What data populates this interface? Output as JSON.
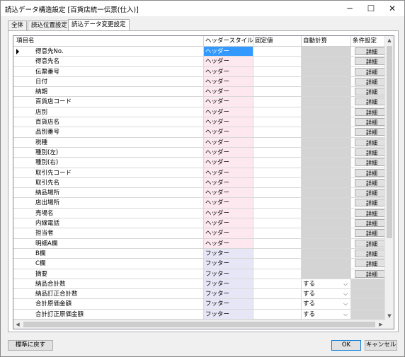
{
  "window": {
    "title": "読込データ構造設定 [百貨店統一伝票(仕入)]",
    "minimize": "─",
    "maximize": "☐",
    "close": "✕"
  },
  "tabs": [
    {
      "label": "全体"
    },
    {
      "label": "読込位置設定"
    },
    {
      "label": "読込データ変更設定"
    }
  ],
  "grid": {
    "columns": {
      "name": "項目名",
      "header_style": "ヘッダースタイル",
      "fixed": "固定値",
      "auto": "自動計算",
      "cond": "条件設定"
    },
    "detail_label": "詳細",
    "rows": [
      {
        "name": "得意先No.",
        "style": "ヘッダー",
        "kind": "h",
        "auto": "",
        "cond": true,
        "selected": true
      },
      {
        "name": "得意先名",
        "style": "ヘッダー",
        "kind": "h",
        "auto": "",
        "cond": true
      },
      {
        "name": "伝票番号",
        "style": "ヘッダー",
        "kind": "h",
        "auto": "",
        "cond": true
      },
      {
        "name": "日付",
        "style": "ヘッダー",
        "kind": "h",
        "auto": "",
        "cond": true
      },
      {
        "name": "納期",
        "style": "ヘッダー",
        "kind": "h",
        "auto": "",
        "cond": true
      },
      {
        "name": "百貨店コード",
        "style": "ヘッダー",
        "kind": "h",
        "auto": "",
        "cond": true
      },
      {
        "name": "店別",
        "style": "ヘッダー",
        "kind": "h",
        "auto": "",
        "cond": true
      },
      {
        "name": "百貨店名",
        "style": "ヘッダー",
        "kind": "h",
        "auto": "",
        "cond": true
      },
      {
        "name": "品別番号",
        "style": "ヘッダー",
        "kind": "h",
        "auto": "",
        "cond": true
      },
      {
        "name": "税種",
        "style": "ヘッダー",
        "kind": "h",
        "auto": "",
        "cond": true
      },
      {
        "name": "種別(左)",
        "style": "ヘッダー",
        "kind": "h",
        "auto": "",
        "cond": true
      },
      {
        "name": "種別(右)",
        "style": "ヘッダー",
        "kind": "h",
        "auto": "",
        "cond": true
      },
      {
        "name": "取引先コード",
        "style": "ヘッダー",
        "kind": "h",
        "auto": "",
        "cond": true
      },
      {
        "name": "取引先名",
        "style": "ヘッダー",
        "kind": "h",
        "auto": "",
        "cond": true
      },
      {
        "name": "納品場所",
        "style": "ヘッダー",
        "kind": "h",
        "auto": "",
        "cond": true
      },
      {
        "name": "店出場所",
        "style": "ヘッダー",
        "kind": "h",
        "auto": "",
        "cond": true
      },
      {
        "name": "売場名",
        "style": "ヘッダー",
        "kind": "h",
        "auto": "",
        "cond": true
      },
      {
        "name": "内線電話",
        "style": "ヘッダー",
        "kind": "h",
        "auto": "",
        "cond": true
      },
      {
        "name": "担当者",
        "style": "ヘッダー",
        "kind": "h",
        "auto": "",
        "cond": true
      },
      {
        "name": "明細A欄",
        "style": "ヘッダー",
        "kind": "h",
        "auto": "",
        "cond": true
      },
      {
        "name": "B欄",
        "style": "フッター",
        "kind": "f",
        "auto": "",
        "cond": true
      },
      {
        "name": "C欄",
        "style": "フッター",
        "kind": "f",
        "auto": "",
        "cond": true
      },
      {
        "name": "摘要",
        "style": "フッター",
        "kind": "f",
        "auto": "",
        "cond": true
      },
      {
        "name": "納品合計数",
        "style": "フッター",
        "kind": "f",
        "auto": "する",
        "cond": false
      },
      {
        "name": "納品訂正合計数",
        "style": "フッター",
        "kind": "f",
        "auto": "する",
        "cond": false
      },
      {
        "name": "合計原価金額",
        "style": "フッター",
        "kind": "f",
        "auto": "する",
        "cond": false
      },
      {
        "name": "合計訂正原価金額",
        "style": "フッター",
        "kind": "f",
        "auto": "する",
        "cond": false
      },
      {
        "name": "",
        "style": "",
        "kind": "f",
        "auto": "",
        "cond": false
      }
    ]
  },
  "buttons": {
    "reset": "標準に戻す",
    "ok": "OK",
    "cancel": "キャンセル"
  },
  "icons": {
    "row_indicator": "triangle-right",
    "dropdown": "chevron-down",
    "scroll_up": "▲",
    "scroll_down": "▼",
    "scroll_left": "◀",
    "scroll_right": "▶"
  }
}
